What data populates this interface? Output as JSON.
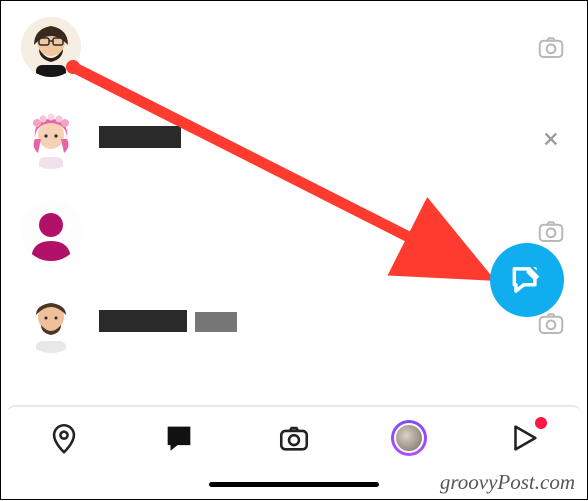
{
  "chats": [
    {
      "avatar": "man-beard-glasses",
      "right_action": "camera"
    },
    {
      "avatar": "girl-pink-flowers",
      "right_action": "close",
      "redacted": true,
      "redact_style": "dark",
      "redact_width": 82
    },
    {
      "avatar": "silhouette-magenta",
      "right_action": "camera"
    },
    {
      "avatar": "man-beard-short",
      "right_action": "camera",
      "redacted": true,
      "redact_style": "dark",
      "redact_width": 88,
      "redact2_width": 42
    }
  ],
  "fab": {
    "icon": "new-message"
  },
  "nav": {
    "items": [
      {
        "icon": "map-pin"
      },
      {
        "icon": "chat-filled",
        "active": true
      },
      {
        "icon": "camera"
      },
      {
        "icon": "stories"
      },
      {
        "icon": "play",
        "badge": true
      }
    ]
  },
  "watermark": "groovyPost.com",
  "colors": {
    "accent": "#10adef",
    "badge": "#ff1744",
    "arrow": "#ff3b30"
  }
}
